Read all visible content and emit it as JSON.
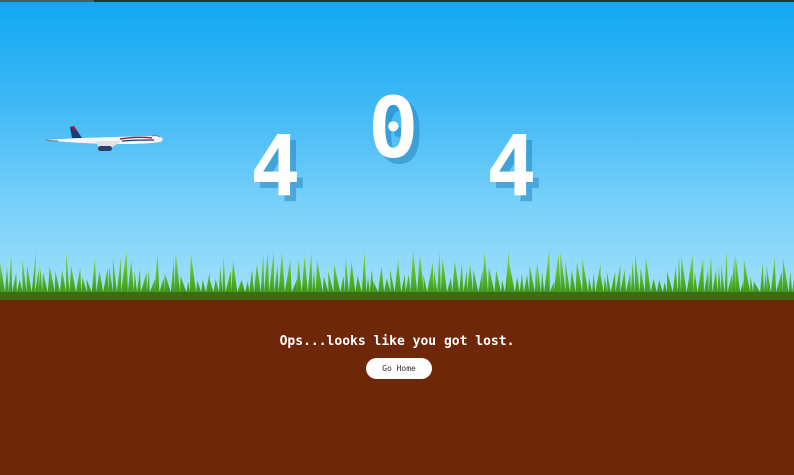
{
  "error": {
    "digits": [
      "4",
      "0",
      "4"
    ]
  },
  "message": {
    "text": "Ops...looks like you got lost."
  },
  "actions": {
    "home_label": "Go Home"
  },
  "colors": {
    "sky_top": "#11a9f4",
    "sky_bottom": "#9fdffb",
    "grass": "#5cbf2a",
    "soil": "#6e2709",
    "text": "#ffffff"
  },
  "icons": {
    "plane": "airplane-icon"
  }
}
